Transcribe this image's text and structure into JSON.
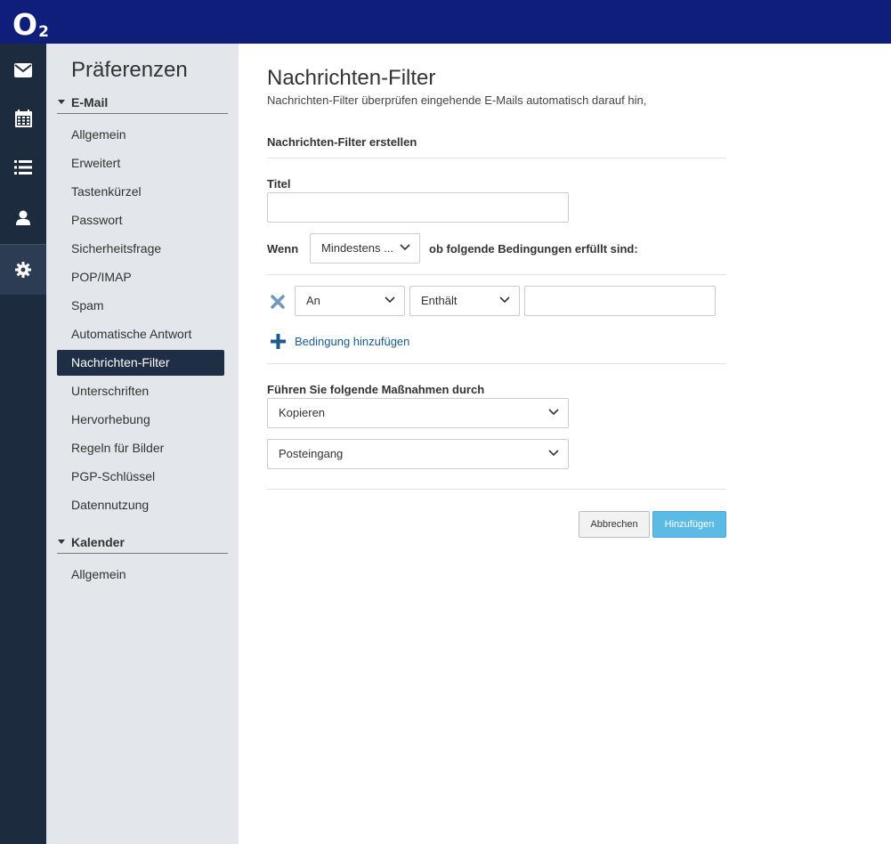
{
  "app": {
    "logo_main": "O",
    "logo_sub": "2"
  },
  "rail": {
    "items": [
      {
        "icon": "mail-icon"
      },
      {
        "icon": "calendar-icon"
      },
      {
        "icon": "list-icon"
      },
      {
        "icon": "contact-icon"
      },
      {
        "icon": "gear-icon",
        "active": true
      }
    ]
  },
  "sidebar": {
    "title": "Präferenzen",
    "sections": [
      {
        "label": "E-Mail",
        "items": [
          "Allgemein",
          "Erweitert",
          "Tastenkürzel",
          "Passwort",
          "Sicherheitsfrage",
          "POP/IMAP",
          "Spam",
          "Automatische Antwort",
          "Nachrichten-Filter",
          "Unterschriften",
          "Hervorhebung",
          "Regeln für Bilder",
          "PGP-Schlüssel",
          "Datennutzung"
        ],
        "active_item": "Nachrichten-Filter"
      },
      {
        "label": "Kalender",
        "items": [
          "Allgemein"
        ]
      }
    ]
  },
  "main": {
    "title": "Nachrichten-Filter",
    "description": "Nachrichten-Filter überprüfen eingehende E-Mails automatisch darauf hin,",
    "section_title": "Nachrichten-Filter erstellen",
    "title_label": "Titel",
    "title_value": "",
    "when_label": "Wenn",
    "match_select": "Mindestens ...",
    "conditions_suffix": "ob folgende Bedingungen erfüllt sind:",
    "condition": {
      "field": "An",
      "operator": "Enthält",
      "value": ""
    },
    "add_condition": "Bedingung hinzufügen",
    "actions_label": "Führen Sie folgende Maßnahmen durch",
    "action_select": "Kopieren",
    "folder_select": "Posteingang",
    "cancel_button": "Abbrechen",
    "add_button": "Hinzufügen"
  },
  "colors": {
    "topbar": "#0f1e7a",
    "rail": "#1d2b3f",
    "sidebar": "#e3e6ea",
    "active_item": "#1e2e45",
    "primary_button": "#5bbbe4",
    "link": "#1b5b8f"
  }
}
